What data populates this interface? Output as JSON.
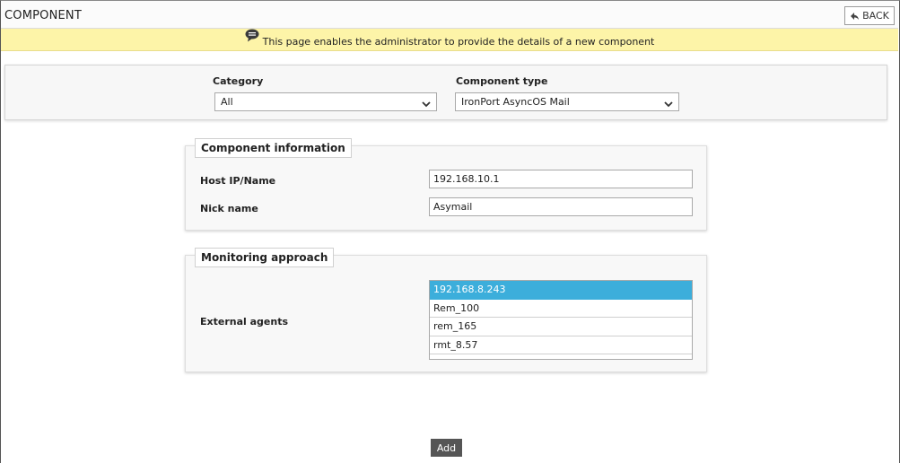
{
  "header": {
    "title": "COMPONENT",
    "back_label": "BACK"
  },
  "info_banner": {
    "icon": "comment-icon",
    "text": "This page enables the administrator to provide the details of a new component"
  },
  "filters": {
    "category": {
      "label": "Category",
      "value": "All"
    },
    "component_type": {
      "label": "Component type",
      "value": "IronPort AsyncOS Mail"
    }
  },
  "component_info": {
    "legend": "Component information",
    "host": {
      "label": "Host IP/Name",
      "value": "192.168.10.1"
    },
    "nickname": {
      "label": "Nick name",
      "value": "Asymail"
    }
  },
  "monitoring": {
    "legend": "Monitoring approach",
    "agents_label": "External agents",
    "agents": [
      "192.168.8.243",
      "Rem_100",
      "rem_165",
      "rmt_8.57"
    ],
    "selected_agent": "192.168.8.243",
    "selected_color": "#3caedb"
  },
  "actions": {
    "add_label": "Add"
  },
  "colors": {
    "info_banner_bg": "#fdf4a8",
    "add_button_bg": "#555555"
  }
}
